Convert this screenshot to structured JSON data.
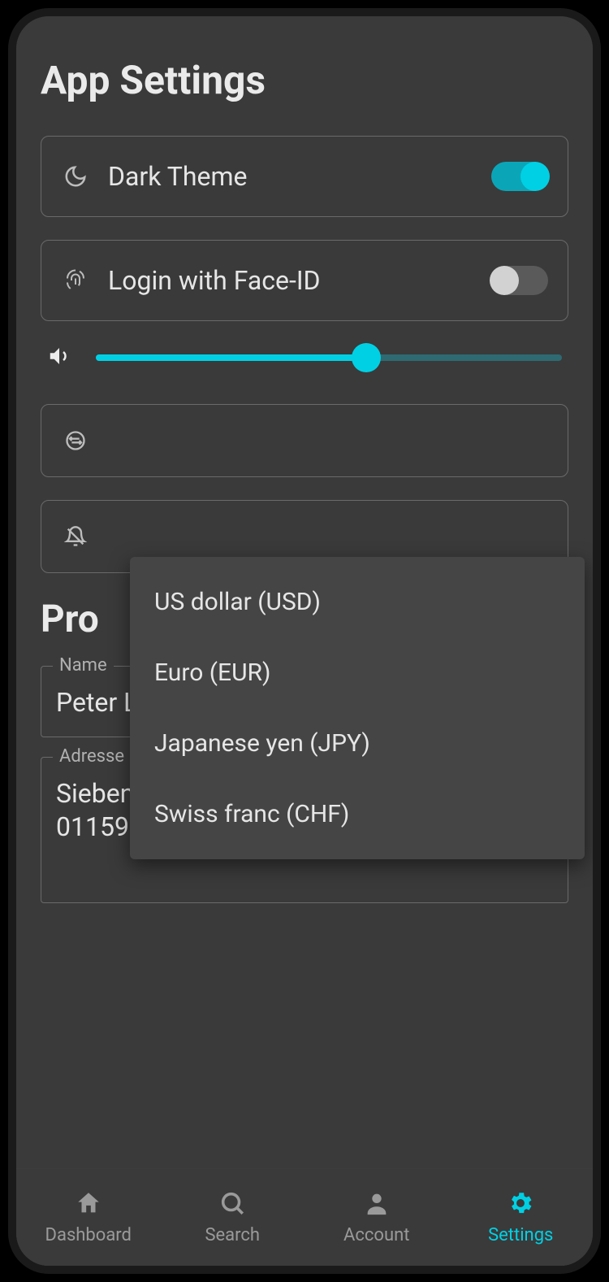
{
  "header": {
    "title": "App Settings"
  },
  "settings": {
    "dark_theme": {
      "label": "Dark Theme",
      "on": true
    },
    "face_id": {
      "label": "Login with Face-ID",
      "on": false
    },
    "volume": {
      "value": 58
    }
  },
  "currency_dropdown": {
    "options": [
      "US dollar (USD)",
      "Euro (EUR)",
      "Japanese yen (JPY)",
      "Swiss franc (CHF)"
    ]
  },
  "profile": {
    "section_title_partial": "Pro",
    "name_label": "Name",
    "name_value": "Peter Larsen",
    "address_label": "Adresse",
    "address_value": "Siebenstraße 24\n01159 Dresden"
  },
  "nav": {
    "items": [
      {
        "label": "Dashboard",
        "active": false
      },
      {
        "label": "Search",
        "active": false
      },
      {
        "label": "Account",
        "active": false
      },
      {
        "label": "Settings",
        "active": true
      }
    ]
  },
  "colors": {
    "accent": "#00d0e4",
    "bg": "#3a3a3a",
    "text": "#e6e6e6",
    "muted": "#9a9a9a"
  }
}
